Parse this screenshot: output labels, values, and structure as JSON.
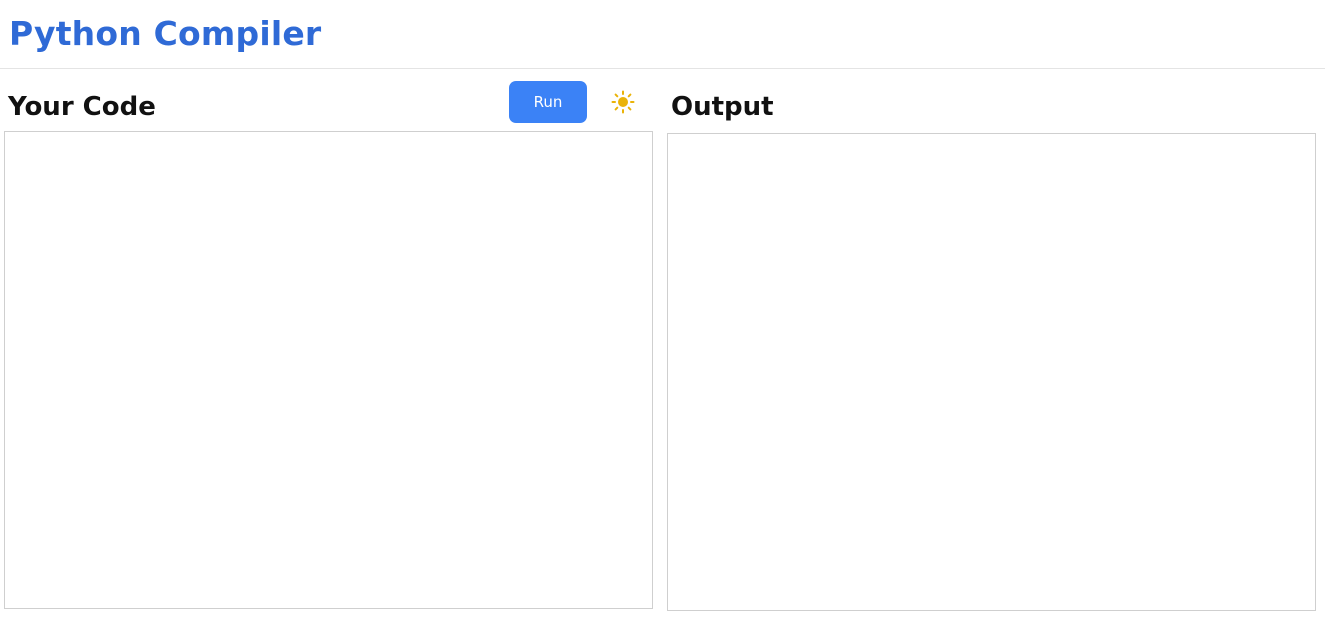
{
  "header": {
    "title": "Python Compiler"
  },
  "editor": {
    "heading": "Your Code",
    "value": "",
    "run_label": "Run",
    "theme_icon": "sun-icon"
  },
  "output": {
    "heading": "Output",
    "value": ""
  },
  "colors": {
    "accent": "#2f6ad6",
    "button": "#3b82f6",
    "sun": "#eab308",
    "border": "#cfcfcf"
  }
}
